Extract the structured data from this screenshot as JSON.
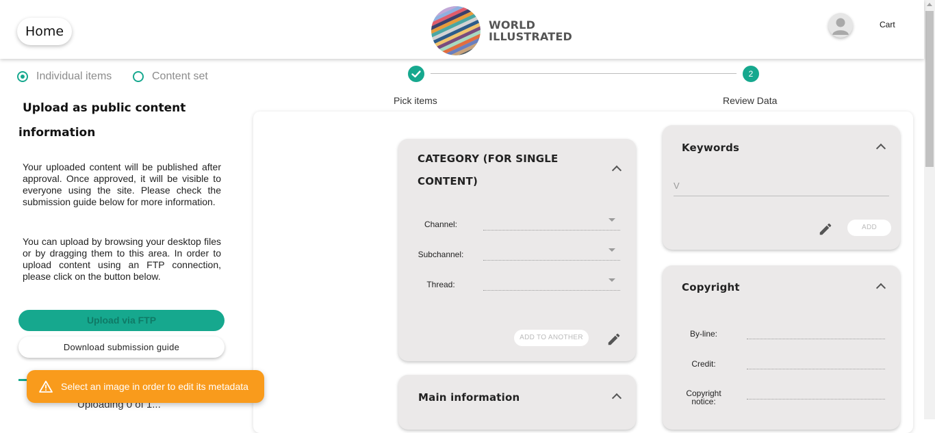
{
  "header": {
    "home_label": "Home",
    "logo_line1": "WORLD",
    "logo_line2": "ILLUSTRATED",
    "cart_label": "Cart",
    "icons": {
      "avatar": "user-avatar-icon"
    }
  },
  "left": {
    "radio_individual": "Individual items",
    "radio_contentset": "Content set",
    "selected_radio": "Individual items",
    "title_line1": "Upload as public content",
    "title_line2": "information",
    "para1": "Your uploaded content will be published after approval. Once approved, it will be visible to everyone using the site. Please check the submission guide below for more information.",
    "para2": "You can upload by browsing your desktop files or by dragging them to this area. In order to upload content using an FTP connection, please click on the button below.",
    "ftp_button": "Upload via FTP",
    "guide_button": "Download submission guide",
    "uploading_text": "Uploading 0 of 1..."
  },
  "toast": {
    "message": "Select an image in order to edit its metadata",
    "icon": "warning-icon"
  },
  "stepper": {
    "step1_label": "Pick items",
    "step2_label": "Review Data",
    "step2_number": "2",
    "step1_icon": "check-icon"
  },
  "category": {
    "title_line1": "CATEGORY (FOR SINGLE",
    "title_line2": "CONTENT)",
    "channel_label": "Channel:",
    "subchannel_label": "Subchannel:",
    "thread_label": "Thread:",
    "add_another": "ADD TO ANOTHER"
  },
  "main_info": {
    "title": "Main information"
  },
  "keywords": {
    "title": "Keywords",
    "input_value": "V",
    "add_button": "ADD"
  },
  "copyright": {
    "title": "Copyright",
    "byline_label": "By-line:",
    "credit_label": "Credit:",
    "notice_label_line1": "Copyright",
    "notice_label_line2": "notice:"
  },
  "colors": {
    "accent": "#16a88e",
    "toast": "#f99b1c",
    "panel_bg": "#ebe9e9"
  }
}
